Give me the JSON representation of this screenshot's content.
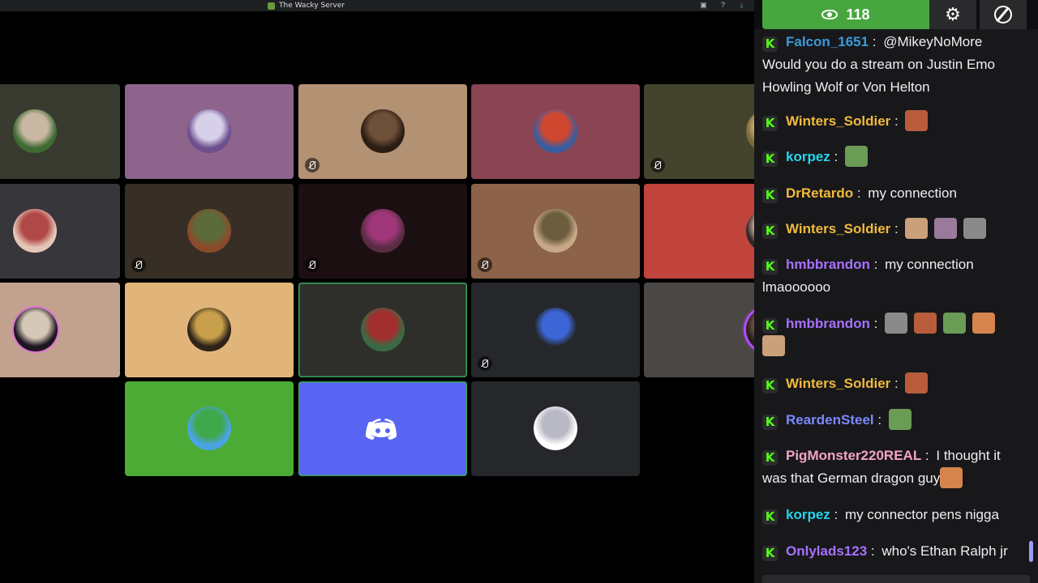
{
  "window": {
    "title": "The Wacky Server"
  },
  "participants": [
    {
      "bg": "#383a2f",
      "muted": false,
      "avatar": [
        "#3e6b32",
        "#c9b7a3"
      ]
    },
    {
      "bg": "#8e648c",
      "muted": false,
      "avatar": [
        "#6d4f8f",
        "#d6d0e8"
      ]
    },
    {
      "bg": "#b39173",
      "muted": true,
      "avatar": [
        "#2c1d14",
        "#6e5038"
      ]
    },
    {
      "bg": "#8a4453",
      "muted": false,
      "avatar": [
        "#3a5da0",
        "#d0472f"
      ]
    },
    {
      "bg": "#44442e",
      "muted": true,
      "avatar": [
        "#7a6a3a",
        "#d4b27a"
      ]
    },
    {
      "bg": "#37363a",
      "muted": false,
      "avatar": [
        "#e5c6b6",
        "#b14848"
      ]
    },
    {
      "bg": "#372e25",
      "muted": true,
      "avatar": [
        "#8b4b2b",
        "#5c6b3a"
      ]
    },
    {
      "bg": "#1c0f11",
      "muted": true,
      "avatar": [
        "#5a2c44",
        "#a1377b"
      ]
    },
    {
      "bg": "#8c6348",
      "muted": true,
      "avatar": [
        "#c7a887",
        "#6b5d3d"
      ]
    },
    {
      "bg": "#c0433c",
      "muted": false,
      "avatar": [
        "#2e2a2a",
        "#d7b19a"
      ]
    },
    {
      "bg": "#c2a28f",
      "muted": false,
      "avatar": [
        "#1d1620",
        "#d6c8b8"
      ]
    },
    {
      "bg": "#e1b57a",
      "muted": false,
      "avatar": [
        "#2d2318",
        "#c8a04c"
      ]
    },
    {
      "bg": "#2e2e2b",
      "muted": false,
      "avatar": [
        "#3a6a44",
        "#a32e2e"
      ]
    },
    {
      "bg": "#25272b",
      "muted": true,
      "avatar": [
        "#25272b",
        "#3c66d6"
      ]
    },
    {
      "bg": "#4a4744",
      "muted": false,
      "avatar": [
        "#2a1e1b",
        "#7a5b4b"
      ]
    },
    {
      "bg": "#4cab34",
      "muted": false,
      "avatar": [
        "#4aa3e3",
        "#3fa84a"
      ]
    },
    {
      "bg": "#5865f2",
      "muted": false,
      "avatar": [
        "#5865f2",
        "#ffffff"
      ]
    },
    {
      "bg": "#25272b",
      "muted": false,
      "avatar": [
        "#ffffff",
        "#b9b9c6"
      ]
    }
  ],
  "chat": {
    "viewer_count": "118",
    "icons": {
      "viewers": "eye-icon",
      "settings": "gear-icon",
      "other": "no-sign-icon",
      "badge": "kick-badge-icon"
    },
    "messages": [
      {
        "user": "Falcon_1651",
        "color": "#3a9bdc",
        "text": "@MikeyNoMore Would you do a stream on Justin Emo Howling Wolf or Von Helton"
      },
      {
        "user": "Winters_Soldier",
        "color": "#f2ba3d",
        "text": "",
        "emotes": 1
      },
      {
        "user": "korpez",
        "color": "#22d7ec",
        "text": "",
        "emotes": 1
      },
      {
        "user": "DrRetardo",
        "color": "#f2ba3d",
        "text": "my connection"
      },
      {
        "user": "Winters_Soldier",
        "color": "#f2ba3d",
        "text": "",
        "emotes": 3
      },
      {
        "user": "hmbbrandon",
        "color": "#a871ff",
        "text": "my connection lmaoooooo"
      },
      {
        "user": "hmbbrandon",
        "color": "#a871ff",
        "text": "",
        "emotes": 5
      },
      {
        "user": "Winters_Soldier",
        "color": "#f2ba3d",
        "text": "",
        "emotes": 1
      },
      {
        "user": "ReardenSteel",
        "color": "#7b88ff",
        "text": "",
        "emotes": 1
      },
      {
        "user": "PigMonster220REAL",
        "color": "#f5a3c7",
        "text": "I thought it was that German dragon guy"
      },
      {
        "user": "korpez",
        "color": "#22d7ec",
        "text": "my connector pens nigga"
      },
      {
        "user": "Onlylads123",
        "color": "#a871ff",
        "text": "who's Ethan Ralph jr"
      }
    ]
  }
}
